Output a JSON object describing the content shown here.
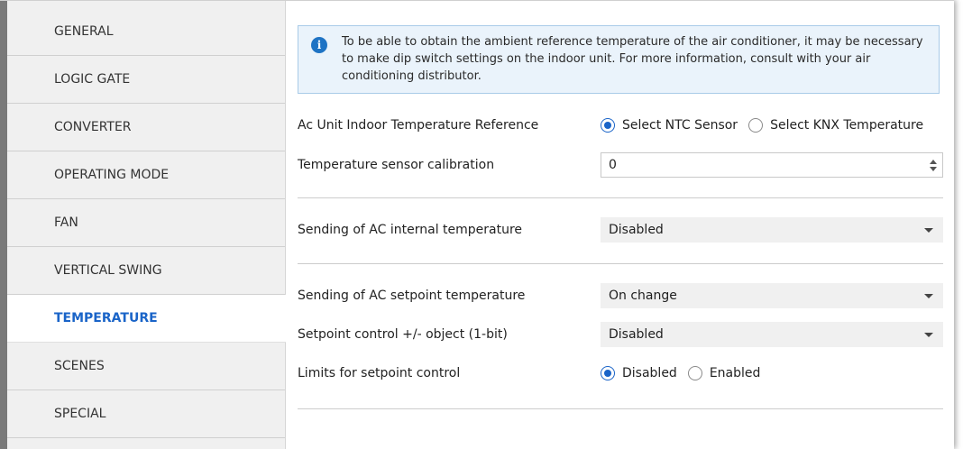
{
  "sidebar": {
    "items": [
      {
        "label": "GENERAL"
      },
      {
        "label": "LOGIC GATE"
      },
      {
        "label": "CONVERTER"
      },
      {
        "label": "OPERATING MODE"
      },
      {
        "label": "FAN"
      },
      {
        "label": "VERTICAL SWING"
      },
      {
        "label": "TEMPERATURE"
      },
      {
        "label": "SCENES"
      },
      {
        "label": "SPECIAL"
      }
    ],
    "active": "TEMPERATURE"
  },
  "info": {
    "text": "To be able to obtain the ambient reference temperature of the air conditioner, it may be necessary to make dip switch settings on the indoor unit. For more information, consult with your air conditioning distributor."
  },
  "settings": {
    "indoor_ref": {
      "label": "Ac Unit Indoor Temperature Reference",
      "options": [
        "Select NTC Sensor",
        "Select KNX Temperature"
      ],
      "selected": "Select NTC Sensor"
    },
    "calibration": {
      "label": "Temperature sensor calibration",
      "value": "0"
    },
    "internal_temp": {
      "label": "Sending of AC internal temperature",
      "value": "Disabled"
    },
    "setpoint_temp": {
      "label": "Sending of AC setpoint temperature",
      "value": "On change"
    },
    "setpoint_control": {
      "label": "Setpoint control +/- object (1-bit)",
      "value": "Disabled"
    },
    "limits": {
      "label": "Limits for setpoint control",
      "options": [
        "Disabled",
        "Enabled"
      ],
      "selected": "Disabled"
    }
  },
  "colors": {
    "accent": "#1a64c8",
    "info_bg": "#eaf3fb",
    "sidebar_bg": "#f0f0f0"
  }
}
